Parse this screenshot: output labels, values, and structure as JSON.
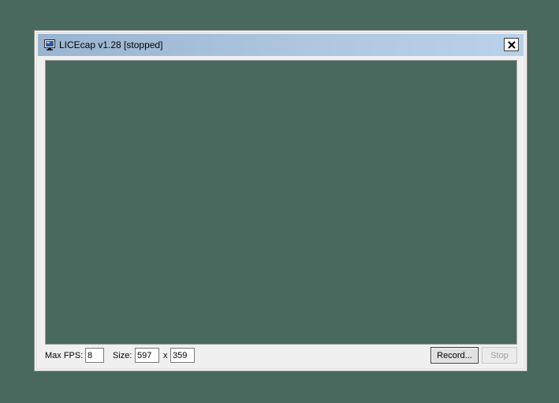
{
  "window": {
    "title": "LICEcap v1.28 [stopped]",
    "close_icon": "close-x-icon",
    "app_icon": "monitor-icon"
  },
  "controls": {
    "max_fps_label": "Max FPS:",
    "max_fps_value": "8",
    "size_label": "Size:",
    "width_value": "597",
    "size_separator": "x",
    "height_value": "359",
    "record_label": "Record...",
    "stop_label": "Stop"
  },
  "colors": {
    "capture_background": "#4a695e",
    "titlebar_start": "#99b4d1",
    "titlebar_end": "#b9d1ea",
    "window_face": "#f0f0f0"
  }
}
